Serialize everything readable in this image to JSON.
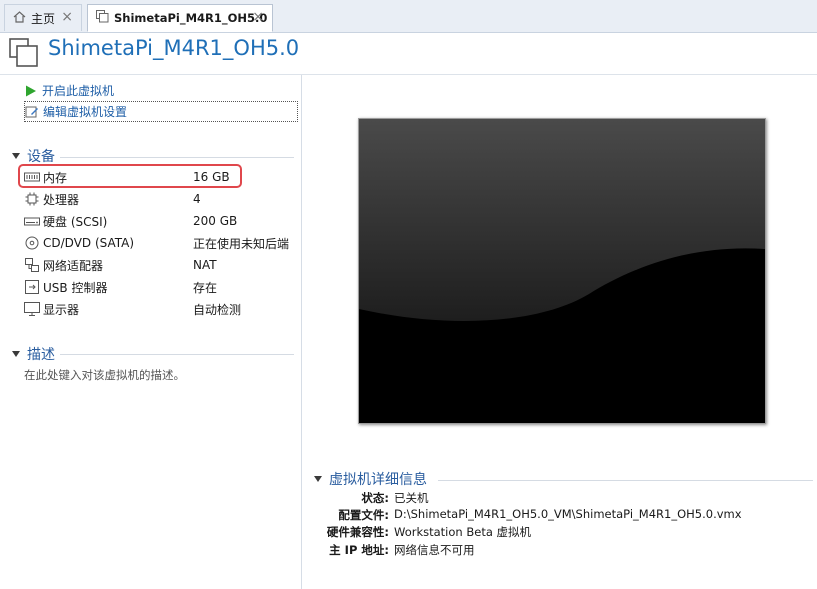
{
  "tabs": [
    {
      "label": "主页",
      "icon": "home-icon"
    },
    {
      "label": "ShimetaPi_M4R1_OH5.0",
      "icon": "vm-tab-icon"
    }
  ],
  "title": "ShimetaPi_M4R1_OH5.0",
  "actions": {
    "power_on": "开启此虚拟机",
    "edit_settings": "编辑虚拟机设置"
  },
  "devices": {
    "heading": "设备",
    "items": [
      {
        "label": "内存",
        "value": "16 GB",
        "icon": "memory-icon"
      },
      {
        "label": "处理器",
        "value": "4",
        "icon": "cpu-icon"
      },
      {
        "label": "硬盘 (SCSI)",
        "value": "200 GB",
        "icon": "hard-disk-icon"
      },
      {
        "label": "CD/DVD (SATA)",
        "value": "正在使用未知后端",
        "icon": "cd-dvd-icon"
      },
      {
        "label": "网络适配器",
        "value": "NAT",
        "icon": "network-adapter-icon"
      },
      {
        "label": "USB 控制器",
        "value": "存在",
        "icon": "usb-icon"
      },
      {
        "label": "显示器",
        "value": "自动检测",
        "icon": "display-icon"
      }
    ]
  },
  "description": {
    "heading": "描述",
    "placeholder": "在此处键入对该虚拟机的描述。"
  },
  "details": {
    "heading": "虚拟机详细信息",
    "rows": [
      {
        "key": "状态:",
        "value": "已关机"
      },
      {
        "key": "配置文件:",
        "value": "D:\\ShimetaPi_M4R1_OH5.0_VM\\ShimetaPi_M4R1_OH5.0.vmx"
      },
      {
        "key": "硬件兼容性:",
        "value": "Workstation Beta 虚拟机"
      },
      {
        "key": "主 IP 地址:",
        "value": "网络信息不可用"
      }
    ]
  },
  "colors": {
    "accent": "#1f6fb7",
    "highlight_border": "#e0474c",
    "power_icon": "#2fa52f"
  }
}
